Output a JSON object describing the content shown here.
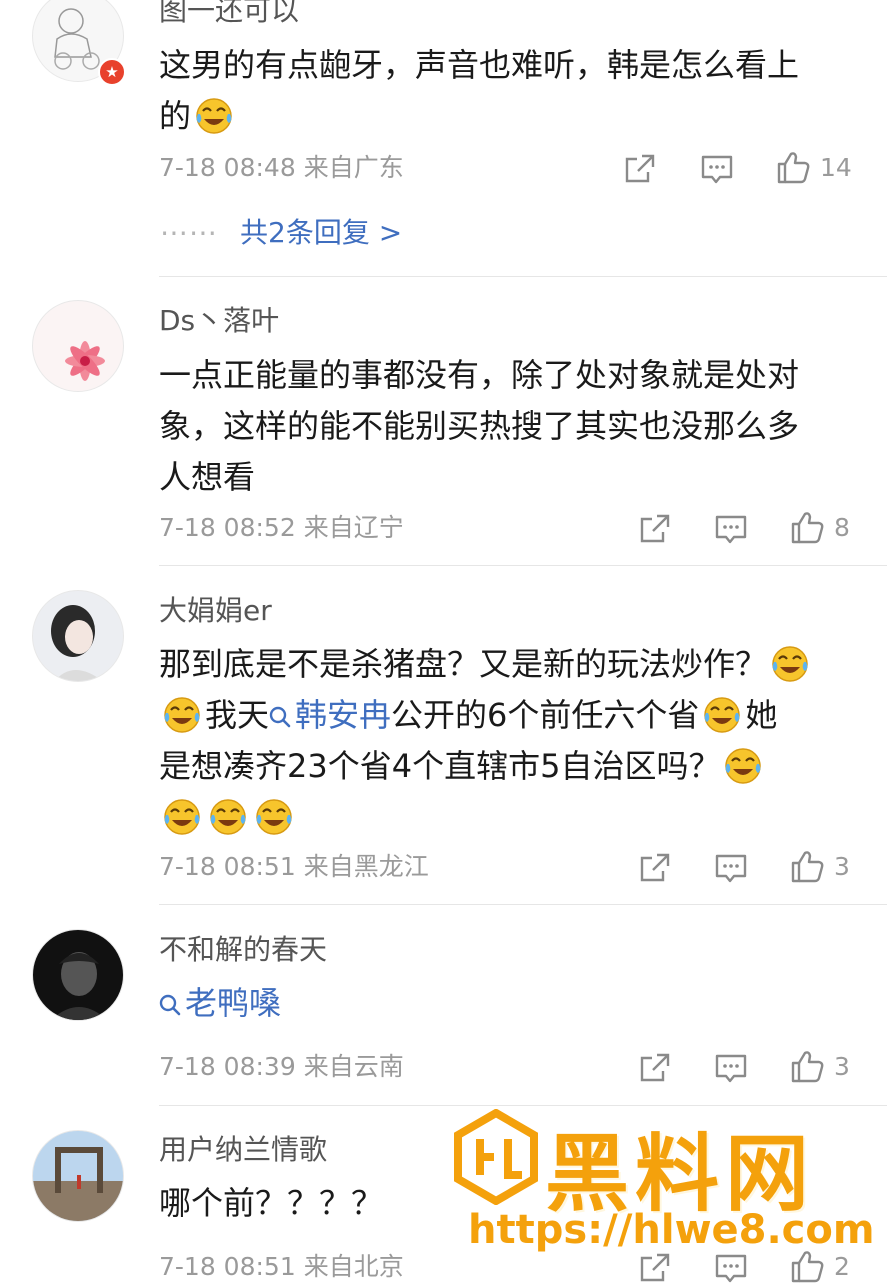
{
  "comments": [
    {
      "username": "图一还可以",
      "verified": true,
      "lines": [
        "这男的有点龅牙，声音也难听，韩是怎么看上",
        "的"
      ],
      "time": "7-18 08:48",
      "location": "来自广东",
      "likes": "14",
      "replies_dots": "⋯⋯",
      "replies_label": "共2条回复 >"
    },
    {
      "username": "Ds丶落叶",
      "lines": [
        "一点正能量的事都没有，除了处对象就是处对",
        "象，这样的能不能别买热搜了其实也没那么多",
        "人想看"
      ],
      "time": "7-18 08:52",
      "location": "来自辽宁",
      "likes": "8"
    },
    {
      "username": "大娟娟er",
      "line1": "那到底是不是杀猪盘？又是新的玩法炒作？",
      "line2_a": "我天",
      "line2_topic": "韩安冉",
      "line2_b": "公开的6个前任六个省",
      "line2_c": "她",
      "line3": "是想凑齐23个省4个直辖市5自治区吗？",
      "time": "7-18 08:51",
      "location": "来自黑龙江",
      "likes": "3"
    },
    {
      "username": "不和解的春天",
      "topic": "老鸭嗓",
      "time": "7-18 08:39",
      "location": "来自云南",
      "likes": "3"
    },
    {
      "username": "用户纳兰情歌",
      "text": "哪个前？？？？",
      "time": "7-18 08:51",
      "location": "来自北京",
      "likes": "2"
    }
  ],
  "watermark": {
    "name": "黑料网",
    "url": "https://hlwe8.com"
  },
  "icons": {
    "share": "share-icon",
    "comment": "comment-icon",
    "like": "like-icon",
    "emoji": "laugh-cry-emoji",
    "topic": "search-icon"
  },
  "colors": {
    "link": "#3f6ebf",
    "meta": "#9a9a9a",
    "watermark": "#f4a10c",
    "badge": "#e8412c"
  }
}
